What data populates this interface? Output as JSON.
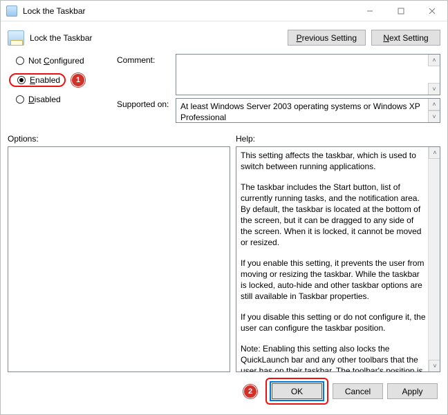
{
  "titlebar": {
    "title": "Lock the Taskbar"
  },
  "header": {
    "policy_title": "Lock the Taskbar",
    "prev_prefix": "P",
    "prev_rest": "revious Setting",
    "next_prefix": "N",
    "next_rest": "ext Setting"
  },
  "radios": {
    "not_configured_prefix": "C",
    "not_configured_label_before": "Not ",
    "not_configured_label_after": "onfigured",
    "enabled_prefix": "E",
    "enabled_rest": "nabled",
    "disabled_prefix": "D",
    "disabled_rest": "isabled",
    "selected": "enabled"
  },
  "annotations": {
    "enabled_badge": "1",
    "ok_badge": "2"
  },
  "fields": {
    "comment_label": "Comment:",
    "comment_value": "",
    "supported_label": "Supported on:",
    "supported_value": "At least Windows Server 2003 operating systems or Windows XP Professional"
  },
  "lower": {
    "options_label": "Options:",
    "help_label": "Help:"
  },
  "help": {
    "p1": "This setting affects the taskbar, which is used to switch between running applications.",
    "p2": "The taskbar includes the Start button, list of currently running tasks, and the notification area. By default, the taskbar is located at the bottom of the screen, but it can be dragged to any side of the screen. When it is locked, it cannot be moved or resized.",
    "p3": "If you enable this setting, it prevents the user from moving or resizing the taskbar. While the taskbar is locked, auto-hide and other taskbar options are still available in Taskbar properties.",
    "p4": "If you disable this setting or do not configure it, the user can configure the taskbar position.",
    "p5": "Note: Enabling this setting also locks the QuickLaunch bar and any other toolbars that the user has on their taskbar. The toolbar's position is locked, and the user cannot show and hide various toolbars using the taskbar context menu."
  },
  "footer": {
    "ok": "OK",
    "cancel": "Cancel",
    "apply_prefix": "A",
    "apply_rest": "pply"
  },
  "glyphs": {
    "up": "˄",
    "down": "˅"
  }
}
